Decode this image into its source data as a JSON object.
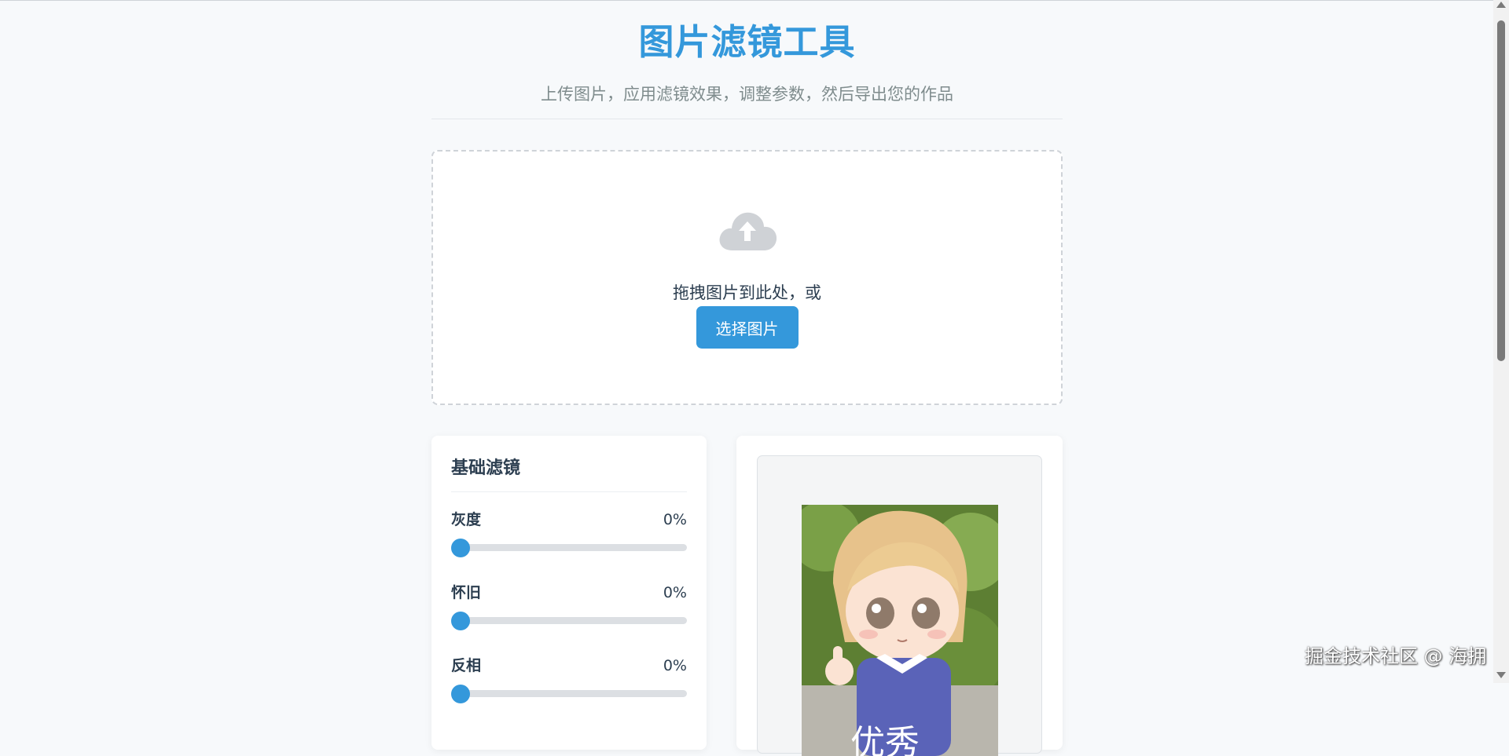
{
  "header": {
    "title": "图片滤镜工具",
    "subtitle": "上传图片，应用滤镜效果，调整参数，然后导出您的作品"
  },
  "upload": {
    "icon": "cloud-upload-icon",
    "prompt": "拖拽图片到此处，或",
    "button_label": "选择图片"
  },
  "controls": {
    "title": "基础滤镜",
    "filters": [
      {
        "name": "灰度",
        "value": "0%",
        "level": 0
      },
      {
        "name": "怀旧",
        "value": "0%",
        "level": 0
      },
      {
        "name": "反相",
        "value": "0%",
        "level": 0
      }
    ]
  },
  "preview": {
    "image_caption": "优秀"
  },
  "watermark": "掘金技术社区 @ 海拥",
  "colors": {
    "accent": "#3498db",
    "background": "#f7f9fb",
    "text": "#2c3e50",
    "muted": "#7f8c8d"
  }
}
